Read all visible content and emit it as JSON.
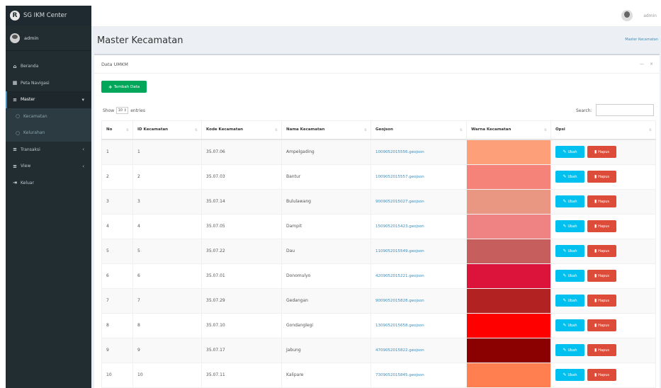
{
  "brand": {
    "logo_letter": "R",
    "title": "SG IKM Center"
  },
  "user": {
    "name": "admin"
  },
  "menu": [
    {
      "icon": "home-icon",
      "glyph": "⌂",
      "label": "Beranda"
    },
    {
      "icon": "map-icon",
      "glyph": "▦",
      "label": "Peta Navigasi"
    },
    {
      "icon": "database-icon",
      "glyph": "≡",
      "label": "Master"
    },
    {
      "icon": "circle-icon",
      "glyph": "○",
      "label": "Kecamatan"
    },
    {
      "icon": "circle-icon",
      "glyph": "○",
      "label": "Kelurahan"
    },
    {
      "icon": "database-icon",
      "glyph": "≡",
      "label": "Transaksi"
    },
    {
      "icon": "database-icon",
      "glyph": "≡",
      "label": "View"
    },
    {
      "icon": "sign-out-icon",
      "glyph": "⇥",
      "label": "Keluar"
    }
  ],
  "topbar": {
    "user": "admin"
  },
  "page": {
    "title": "Master Kecamatan",
    "breadcrumb": "Master Kecamatan"
  },
  "box": {
    "title": "Data UMKM",
    "tools": "— ×",
    "add_button": "Tambah Data",
    "show_prefix": "Show",
    "show_value": "10 ↕",
    "show_suffix": "entries",
    "search_label": "Search:"
  },
  "table": {
    "headers": [
      "No",
      "ID Kecamatan",
      "Kode Kecamatan",
      "Nama Kecamatan",
      "Geojson",
      "Warna Kecamatan",
      "Opsi"
    ],
    "edit_label": "Ubah",
    "delete_label": "Hapus",
    "rows": [
      {
        "no": "1",
        "id": "1",
        "kode": "35.07.06",
        "nama": "Ampelgading",
        "geojson": "1009052015556.geojson",
        "color": "#fda07a"
      },
      {
        "no": "2",
        "id": "2",
        "kode": "35.07.03",
        "nama": "Bantur",
        "geojson": "1009052015557.geojson",
        "color": "#f6837a"
      },
      {
        "no": "3",
        "id": "3",
        "kode": "35.07.14",
        "nama": "Bululawang",
        "geojson": "9009052015027.geojson",
        "color": "#e99783"
      },
      {
        "no": "4",
        "id": "4",
        "kode": "35.07.05",
        "nama": "Dampit",
        "geojson": "1509052015423.geojson",
        "color": "#ef8383"
      },
      {
        "no": "5",
        "id": "5",
        "kode": "35.07.22",
        "nama": "Dau",
        "geojson": "1109052015549.geojson",
        "color": "#c65e5e"
      },
      {
        "no": "6",
        "id": "6",
        "kode": "35.07.01",
        "nama": "Donomulyo",
        "geojson": "4209052015221.geojson",
        "color": "#dc143c"
      },
      {
        "no": "7",
        "id": "7",
        "kode": "35.07.29",
        "nama": "Gedangan",
        "geojson": "9009052015828.geojson",
        "color": "#b22222"
      },
      {
        "no": "8",
        "id": "8",
        "kode": "35.07.10",
        "nama": "Gondanglegi",
        "geojson": "1309052015658.geojson",
        "color": "#ff0000"
      },
      {
        "no": "9",
        "id": "9",
        "kode": "35.07.17",
        "nama": "Jabung",
        "geojson": "4709052015822.geojson",
        "color": "#8b0000"
      },
      {
        "no": "10",
        "id": "10",
        "kode": "35.07.11",
        "nama": "Kalipare",
        "geojson": "7309052015845.geojson",
        "color": "#ff7f50"
      }
    ]
  }
}
